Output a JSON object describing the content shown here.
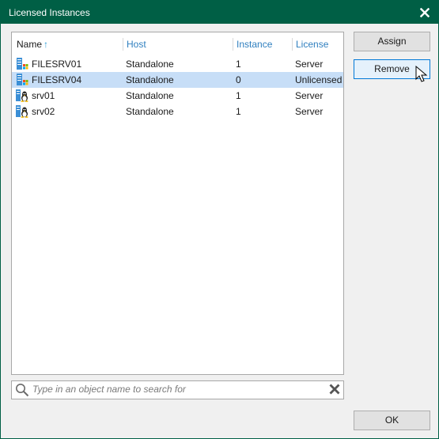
{
  "window": {
    "title": "Licensed Instances"
  },
  "table": {
    "columns": [
      {
        "key": "name",
        "label": "Name",
        "sorted": "ascending"
      },
      {
        "key": "host",
        "label": "Host"
      },
      {
        "key": "instance",
        "label": "Instance"
      },
      {
        "key": "license",
        "label": "License"
      }
    ],
    "sort_indicator": "↑",
    "rows": [
      {
        "name": "FILESRV01",
        "host": "Standalone",
        "instance": "1",
        "license": "Server",
        "icon": "windows-server-icon",
        "selected": false
      },
      {
        "name": "FILESRV04",
        "host": "Standalone",
        "instance": "0",
        "license": "Unlicensed",
        "icon": "windows-server-icon",
        "selected": true
      },
      {
        "name": "srv01",
        "host": "Standalone",
        "instance": "1",
        "license": "Server",
        "icon": "linux-server-icon",
        "selected": false
      },
      {
        "name": "srv02",
        "host": "Standalone",
        "instance": "1",
        "license": "Server",
        "icon": "linux-server-icon",
        "selected": false
      }
    ]
  },
  "search": {
    "placeholder": "Type in an object name to search for",
    "value": ""
  },
  "buttons": {
    "assign": "Assign",
    "remove": "Remove",
    "ok": "OK"
  },
  "colors": {
    "title_bar": "#005f45",
    "selection": "#c7def7",
    "header_link": "#2f7fbf"
  }
}
